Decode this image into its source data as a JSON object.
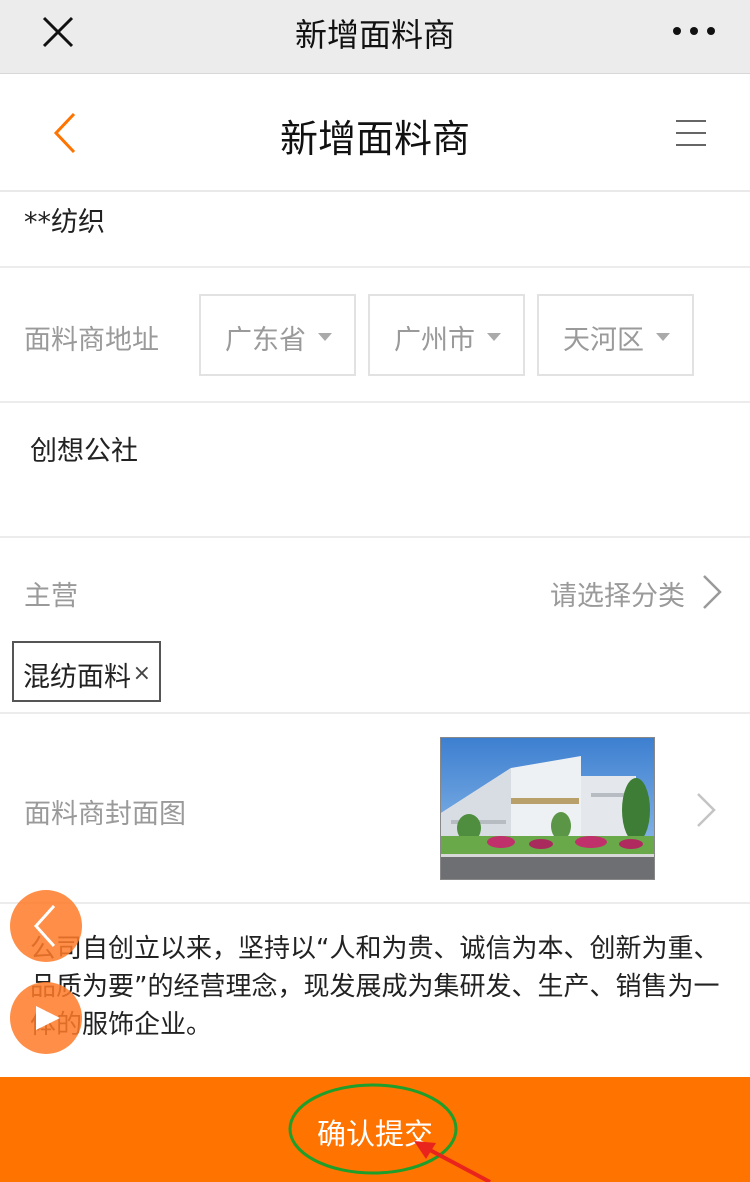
{
  "wechat_bar": {
    "title": "新增面料商",
    "close_icon": "close-icon",
    "more_icon": "more-dots-icon"
  },
  "header": {
    "title": "新增面料商",
    "back_icon": "chevron-left-icon",
    "menu_icon": "hamburger-menu-icon"
  },
  "name_field": {
    "value": "**纺织"
  },
  "address": {
    "label": "面料商地址",
    "province": "广东省",
    "city": "广州市",
    "district": "天河区"
  },
  "detail_address": {
    "value": "创想公社"
  },
  "main_business": {
    "label": "主营",
    "placeholder": "请选择分类",
    "tags": [
      "混纺面料"
    ],
    "remove_symbol": "×"
  },
  "cover_image": {
    "label": "面料商封面图"
  },
  "description": {
    "text": "公司自创立以来，坚持以“人和为贵、诚信为本、创新为重、品质为要”的经营理念，现发展成为集研发、生产、销售为一体的服饰企业。"
  },
  "submit": {
    "label": "确认提交"
  },
  "colors": {
    "accent": "#ff7300",
    "annotation_green": "#1e9e2a",
    "annotation_red": "#e8241c"
  }
}
